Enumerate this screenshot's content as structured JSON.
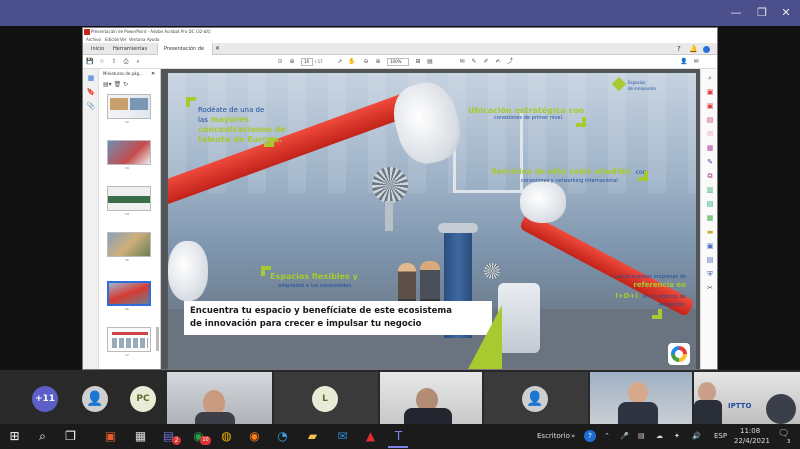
{
  "acrobat": {
    "window_title": "Presentación de PowerPoint - Adobe Acrobat Pro DC (32-bit)",
    "menu": [
      "Archivo",
      "Edición",
      "Ver",
      "Ventana",
      "Ayuda"
    ],
    "tabs": [
      "Inicio",
      "Herramientas",
      "Presentación de Po..."
    ],
    "page_current": "16",
    "page_total": "/ 17",
    "zoom": "100%",
    "thumb_panel_title": "Miniaturas de pág...",
    "thumb_numbers": [
      "12",
      "13",
      "14",
      "15",
      "16",
      "17"
    ]
  },
  "slide": {
    "block1": [
      "Rodéate de una de",
      "las",
      "mayores",
      "concentraciones de",
      "talento de Europa."
    ],
    "block2_title": "Ubicación estratégica con",
    "block2_sub": "conexiones de primer nivel.",
    "block3_title": "Servicios de alto valor añadido",
    "block3_con": "con",
    "block3_sub": "conexiones y networking internacional.",
    "block4_title": "Espacios flexibles y",
    "block4_sub": "adaptados a tus necesidades.",
    "block5": [
      "Las principales empresas de",
      "referencia en",
      "I+D+i",
      "en un entorno de",
      "excepción."
    ],
    "banner_line1": "Encuentra tu espacio y benefíciate de este ecosistema",
    "banner_line2": "de innovación para crecer e impulsar tu negocio",
    "logo_text1": "Espacios",
    "logo_text2": "de innovación"
  },
  "meeting": {
    "overflow_count": "+11",
    "participant_pc": "PC",
    "participant_l": "L",
    "video_caption": "IPTTO"
  },
  "taskbar": {
    "desktop_label": "Escritorio",
    "lang": "ESP",
    "time": "11:08",
    "date": "22/4/2021",
    "badge_chat": "2",
    "badge_mail": "10",
    "notif": "3"
  },
  "colors": {
    "teams_purple": "#4b4f8c",
    "brand_blue": "#1d4e9e",
    "brand_lime": "#a8c930",
    "acrobat_red": "#c7251e"
  }
}
